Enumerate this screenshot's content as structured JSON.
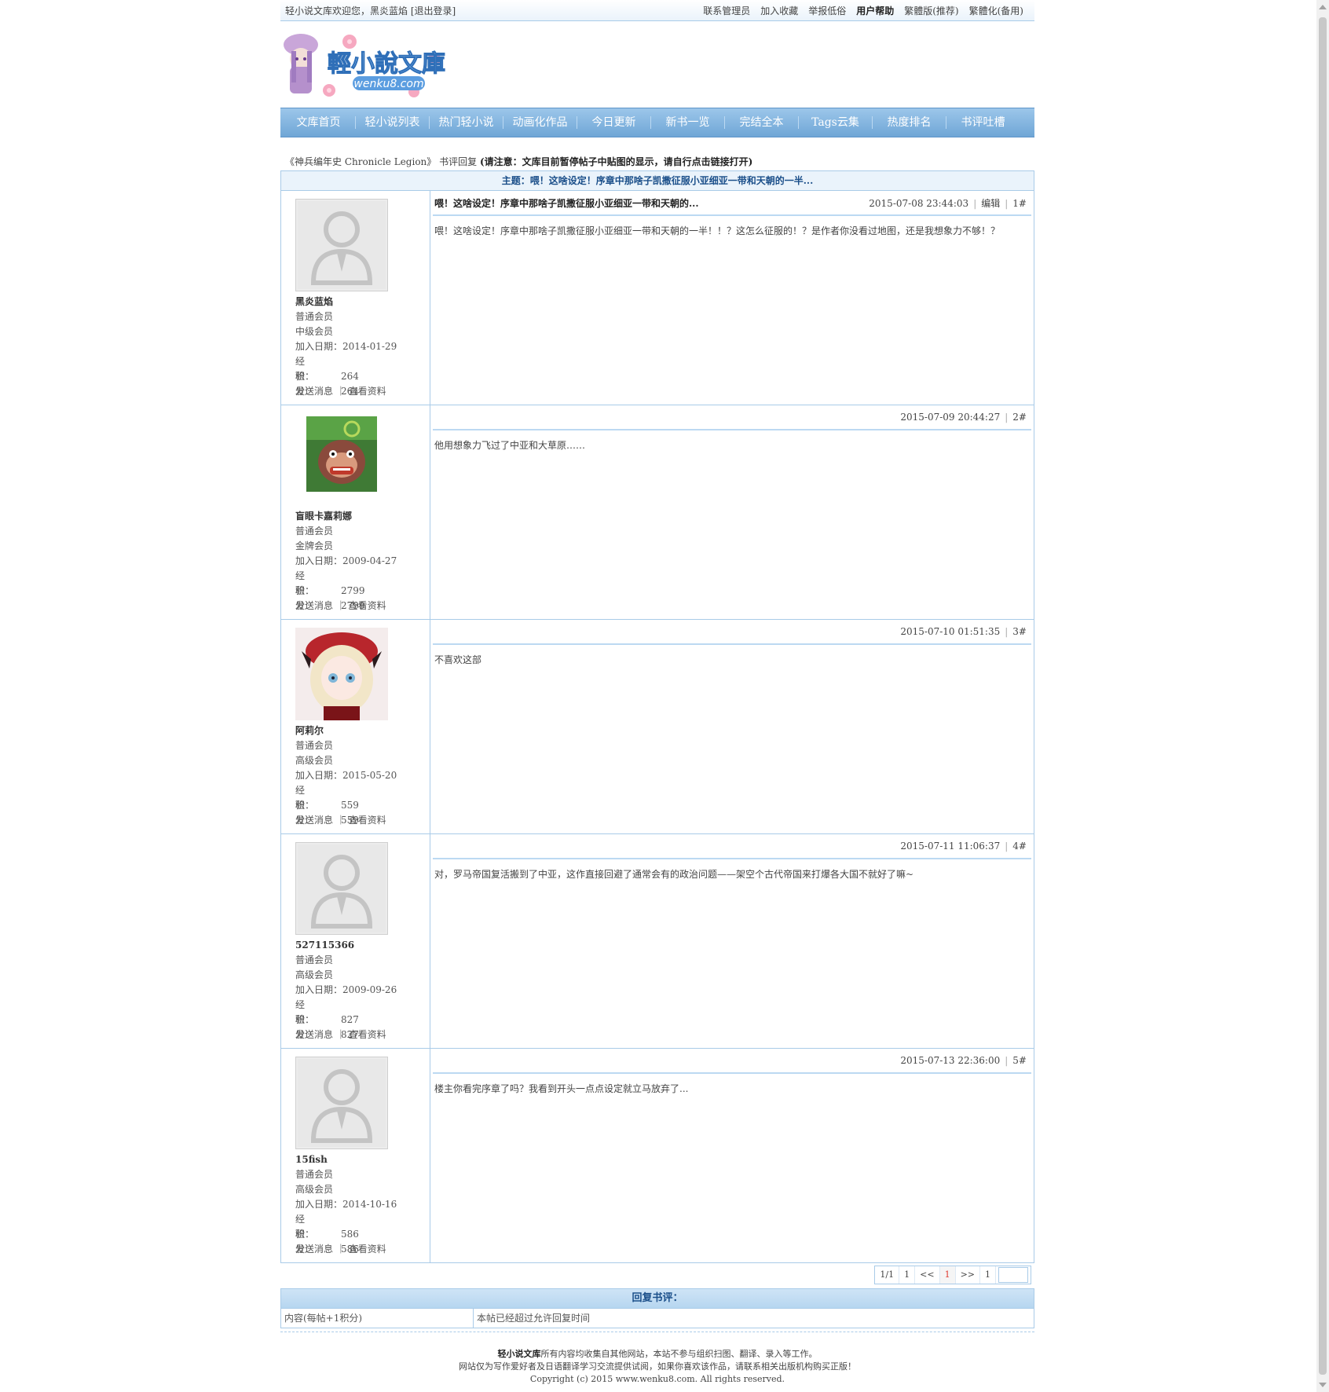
{
  "topbar": {
    "welcome": "轻小说文库欢迎您，黑炎蓝焰 [退出登录]",
    "links": [
      "联系管理员",
      "加入收藏",
      "举报低俗",
      "用户帮助",
      "繁體版(推荐)",
      "繁體化(备用)"
    ]
  },
  "logo": {
    "title": "輕小說文庫",
    "url": "wenku8.com"
  },
  "nav": [
    "文库首页",
    "轻小说列表",
    "热门轻小说",
    "动画化作品",
    "今日更新",
    "新书一览",
    "完结全本",
    "Tags云集",
    "热度排名",
    "书评吐槽"
  ],
  "crumb": {
    "book": "《神兵编年史 Chronicle Legion》",
    "section": "书评回复",
    "notice": "(请注意：文库目前暂停帖子中贴图的显示，请自行点击链接打开)"
  },
  "topic_title": "主题：喂！这啥设定！序章中那啥子凯撒征服小亚细亚一带和天朝的一半...",
  "posts": [
    {
      "name": "黑炎蓝焰",
      "group": "普通会员",
      "level": "中级会员",
      "join_label": "加入日期：",
      "join": "2014-01-29",
      "exp_label": "经　　验：",
      "exp": "264",
      "score_label": "积　　分：",
      "score": "264",
      "actions": "发送消息 ｜ 查看资料",
      "title": "喂！这啥设定！序章中那啥子凯撒征服小亚细亚一带和天朝的...",
      "time": "2015-07-08 23:44:03",
      "edit": "编辑",
      "floor": "1#",
      "body": "喂！这啥设定！序章中那啥子凯撒征服小亚细亚一带和天朝的一半！！？这怎么征服的！？是作者你没看过地图，还是我想象力不够！？"
    },
    {
      "name": "盲眼卡嘉莉娜",
      "group": "普通会员",
      "level": "金牌会员",
      "join_label": "加入日期：",
      "join": "2009-04-27",
      "exp_label": "经　　验：",
      "exp": "2799",
      "score_label": "积　　分：",
      "score": "2799",
      "actions": "发送消息 ｜ 查看资料",
      "title": "",
      "time": "2015-07-09 20:44:27",
      "edit": "",
      "floor": "2#",
      "body": "他用想象力飞过了中亚和大草原……"
    },
    {
      "name": "阿莉尔",
      "group": "普通会员",
      "level": "高级会员",
      "join_label": "加入日期：",
      "join": "2015-05-20",
      "exp_label": "经　　验：",
      "exp": "559",
      "score_label": "积　　分：",
      "score": "559",
      "actions": "发送消息 ｜ 查看资料",
      "title": "",
      "time": "2015-07-10 01:51:35",
      "edit": "",
      "floor": "3#",
      "body": "不喜欢这部"
    },
    {
      "name": "527115366",
      "group": "普通会员",
      "level": "高级会员",
      "join_label": "加入日期：",
      "join": "2009-09-26",
      "exp_label": "经　　验：",
      "exp": "827",
      "score_label": "积　　分：",
      "score": "827",
      "actions": "发送消息 ｜ 查看资料",
      "title": "",
      "time": "2015-07-11 11:06:37",
      "edit": "",
      "floor": "4#",
      "body": "对，罗马帝国复活搬到了中亚，这作直接回避了通常会有的政治问题——架空个古代帝国来打爆各大国不就好了嘛~"
    },
    {
      "name": "15fish",
      "group": "普通会员",
      "level": "高级会员",
      "join_label": "加入日期：",
      "join": "2014-10-16",
      "exp_label": "经　　验：",
      "exp": "586",
      "score_label": "积　　分：",
      "score": "586",
      "actions": "发送消息 ｜ 查看资料",
      "title": "",
      "time": "2015-07-13 22:36:00",
      "edit": "",
      "floor": "5#",
      "body": "楼主你看完序章了吗？我看到开头一点点设定就立马放弃了..."
    }
  ],
  "pager": {
    "info": "1/1",
    "first": "1",
    "prev": "<<",
    "current": "1",
    "next": ">>",
    "last": "1",
    "jump": ""
  },
  "reply": {
    "header": "回复书评：",
    "content_label": "内容(每帖+1积分)",
    "content_value": "本帖已经超过允许回复时间"
  },
  "footer": {
    "line1_bold": "轻小说文库",
    "line1": "所有内容均收集自其他网站，本站不参与组织扫图、翻译、录入等工作。",
    "line2": "网站仅为写作爱好者及日语翻译学习交流提供试阅，如果你喜欢该作品，请联系相关出版机构购买正版！",
    "line3": "Copyright (c) 2015 www.wenku8.com. All rights reserved."
  }
}
